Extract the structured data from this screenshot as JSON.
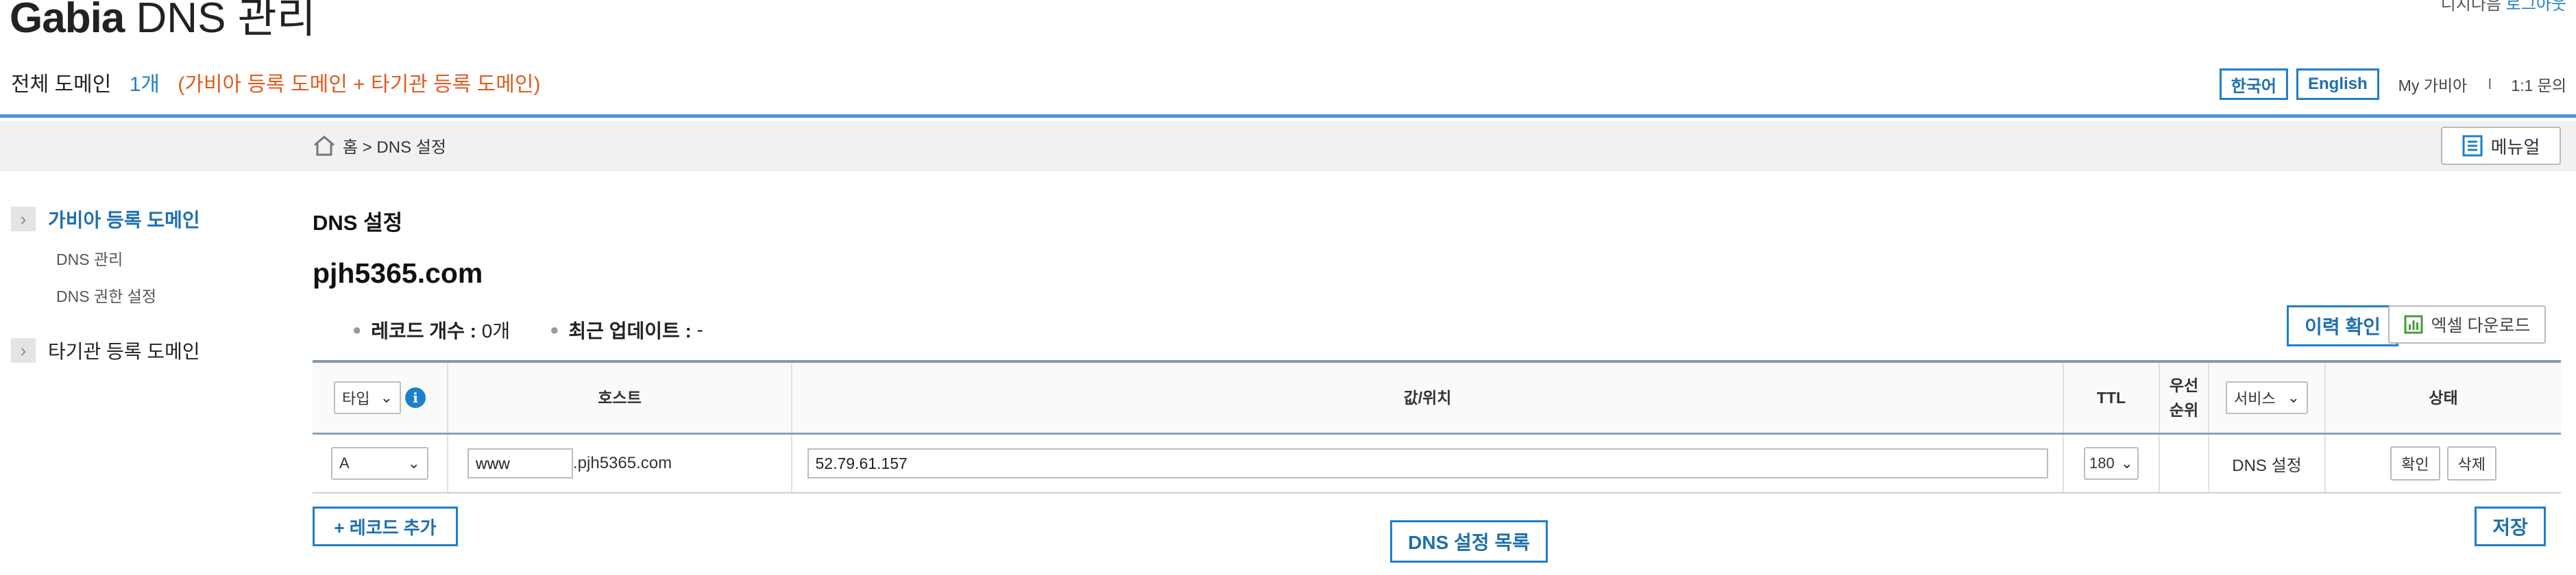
{
  "header": {
    "logo_brand": "Gabia",
    "logo_title": "DNS 관리",
    "topright_text": "디지다음",
    "topright_link": "로그아웃"
  },
  "summary": {
    "label": "전체 도메인",
    "count": "1개",
    "note": "(가비아 등록 도메인 + 타기관 등록 도메인)"
  },
  "util": {
    "lang_ko": "한국어",
    "lang_en": "English",
    "my_gabia": "My 가비아",
    "separator": "I",
    "inquiry": "1:1 문의"
  },
  "breadcrumb": {
    "text": "홈 > DNS 설정"
  },
  "menu_button": "메뉴얼",
  "sidebar": {
    "group1": "가비아 등록 도메인",
    "sub1": "DNS 관리",
    "sub2": "DNS 권한 설정",
    "group2": "타기관 등록 도메인"
  },
  "main": {
    "section_title": "DNS 설정",
    "domain": "pjh5365.com",
    "record_count_label": "레코드 개수 :",
    "record_count_value": "0개",
    "last_update_label": "최근 업데이트 :",
    "last_update_value": "-",
    "history_button": "이력 확인",
    "excel_button": "엑셀 다운로드"
  },
  "table": {
    "headers": {
      "type_select": "타입 ",
      "host": "호스트",
      "value": "값/위치",
      "ttl": "TTL",
      "priority_line1": "우선",
      "priority_line2": "순위",
      "service_select": "서비스",
      "status": "상태"
    },
    "row": {
      "type": "A",
      "host": "www",
      "host_suffix": ".pjh5365.com",
      "value": "52.79.61.157",
      "ttl": "180",
      "priority": "",
      "service": "DNS 설정",
      "confirm": "확인",
      "delete": "삭제"
    }
  },
  "buttons": {
    "add_record": "+ 레코드 추가",
    "dns_list": "DNS 설정 목록",
    "save": "저장"
  },
  "colors": {
    "accent": "#1f7fc9",
    "note": "#e25b1f",
    "header_rule": "#4a97cc"
  }
}
